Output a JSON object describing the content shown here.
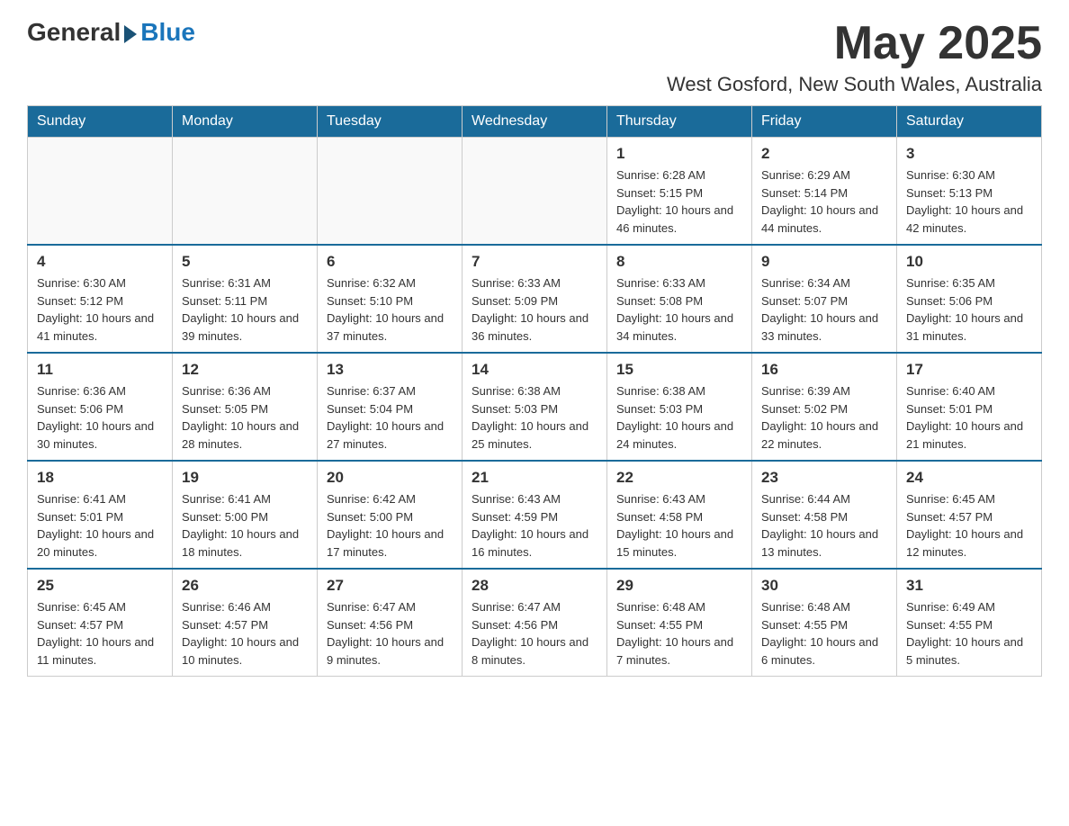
{
  "header": {
    "logo_general": "General",
    "logo_blue": "Blue",
    "month": "May 2025",
    "location": "West Gosford, New South Wales, Australia"
  },
  "days_of_week": [
    "Sunday",
    "Monday",
    "Tuesday",
    "Wednesday",
    "Thursday",
    "Friday",
    "Saturday"
  ],
  "weeks": [
    [
      {
        "day": "",
        "info": ""
      },
      {
        "day": "",
        "info": ""
      },
      {
        "day": "",
        "info": ""
      },
      {
        "day": "",
        "info": ""
      },
      {
        "day": "1",
        "info": "Sunrise: 6:28 AM\nSunset: 5:15 PM\nDaylight: 10 hours and 46 minutes."
      },
      {
        "day": "2",
        "info": "Sunrise: 6:29 AM\nSunset: 5:14 PM\nDaylight: 10 hours and 44 minutes."
      },
      {
        "day": "3",
        "info": "Sunrise: 6:30 AM\nSunset: 5:13 PM\nDaylight: 10 hours and 42 minutes."
      }
    ],
    [
      {
        "day": "4",
        "info": "Sunrise: 6:30 AM\nSunset: 5:12 PM\nDaylight: 10 hours and 41 minutes."
      },
      {
        "day": "5",
        "info": "Sunrise: 6:31 AM\nSunset: 5:11 PM\nDaylight: 10 hours and 39 minutes."
      },
      {
        "day": "6",
        "info": "Sunrise: 6:32 AM\nSunset: 5:10 PM\nDaylight: 10 hours and 37 minutes."
      },
      {
        "day": "7",
        "info": "Sunrise: 6:33 AM\nSunset: 5:09 PM\nDaylight: 10 hours and 36 minutes."
      },
      {
        "day": "8",
        "info": "Sunrise: 6:33 AM\nSunset: 5:08 PM\nDaylight: 10 hours and 34 minutes."
      },
      {
        "day": "9",
        "info": "Sunrise: 6:34 AM\nSunset: 5:07 PM\nDaylight: 10 hours and 33 minutes."
      },
      {
        "day": "10",
        "info": "Sunrise: 6:35 AM\nSunset: 5:06 PM\nDaylight: 10 hours and 31 minutes."
      }
    ],
    [
      {
        "day": "11",
        "info": "Sunrise: 6:36 AM\nSunset: 5:06 PM\nDaylight: 10 hours and 30 minutes."
      },
      {
        "day": "12",
        "info": "Sunrise: 6:36 AM\nSunset: 5:05 PM\nDaylight: 10 hours and 28 minutes."
      },
      {
        "day": "13",
        "info": "Sunrise: 6:37 AM\nSunset: 5:04 PM\nDaylight: 10 hours and 27 minutes."
      },
      {
        "day": "14",
        "info": "Sunrise: 6:38 AM\nSunset: 5:03 PM\nDaylight: 10 hours and 25 minutes."
      },
      {
        "day": "15",
        "info": "Sunrise: 6:38 AM\nSunset: 5:03 PM\nDaylight: 10 hours and 24 minutes."
      },
      {
        "day": "16",
        "info": "Sunrise: 6:39 AM\nSunset: 5:02 PM\nDaylight: 10 hours and 22 minutes."
      },
      {
        "day": "17",
        "info": "Sunrise: 6:40 AM\nSunset: 5:01 PM\nDaylight: 10 hours and 21 minutes."
      }
    ],
    [
      {
        "day": "18",
        "info": "Sunrise: 6:41 AM\nSunset: 5:01 PM\nDaylight: 10 hours and 20 minutes."
      },
      {
        "day": "19",
        "info": "Sunrise: 6:41 AM\nSunset: 5:00 PM\nDaylight: 10 hours and 18 minutes."
      },
      {
        "day": "20",
        "info": "Sunrise: 6:42 AM\nSunset: 5:00 PM\nDaylight: 10 hours and 17 minutes."
      },
      {
        "day": "21",
        "info": "Sunrise: 6:43 AM\nSunset: 4:59 PM\nDaylight: 10 hours and 16 minutes."
      },
      {
        "day": "22",
        "info": "Sunrise: 6:43 AM\nSunset: 4:58 PM\nDaylight: 10 hours and 15 minutes."
      },
      {
        "day": "23",
        "info": "Sunrise: 6:44 AM\nSunset: 4:58 PM\nDaylight: 10 hours and 13 minutes."
      },
      {
        "day": "24",
        "info": "Sunrise: 6:45 AM\nSunset: 4:57 PM\nDaylight: 10 hours and 12 minutes."
      }
    ],
    [
      {
        "day": "25",
        "info": "Sunrise: 6:45 AM\nSunset: 4:57 PM\nDaylight: 10 hours and 11 minutes."
      },
      {
        "day": "26",
        "info": "Sunrise: 6:46 AM\nSunset: 4:57 PM\nDaylight: 10 hours and 10 minutes."
      },
      {
        "day": "27",
        "info": "Sunrise: 6:47 AM\nSunset: 4:56 PM\nDaylight: 10 hours and 9 minutes."
      },
      {
        "day": "28",
        "info": "Sunrise: 6:47 AM\nSunset: 4:56 PM\nDaylight: 10 hours and 8 minutes."
      },
      {
        "day": "29",
        "info": "Sunrise: 6:48 AM\nSunset: 4:55 PM\nDaylight: 10 hours and 7 minutes."
      },
      {
        "day": "30",
        "info": "Sunrise: 6:48 AM\nSunset: 4:55 PM\nDaylight: 10 hours and 6 minutes."
      },
      {
        "day": "31",
        "info": "Sunrise: 6:49 AM\nSunset: 4:55 PM\nDaylight: 10 hours and 5 minutes."
      }
    ]
  ]
}
